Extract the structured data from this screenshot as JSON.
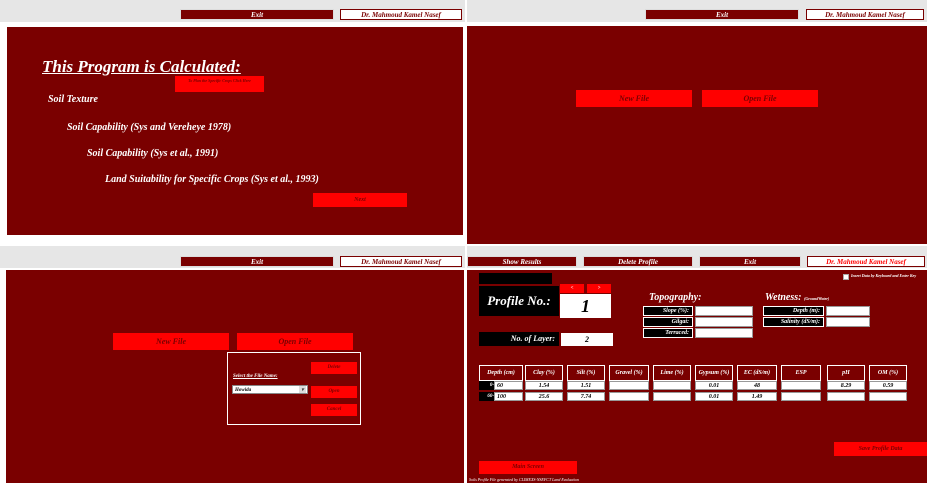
{
  "q1": {
    "exit": "Exit",
    "author": "Dr. Mahmoud Kamel Nasef",
    "heading": "This Program is Calculated:",
    "hint": "To Plan the Specific Crops Click Here",
    "items": [
      "Soil Texture",
      "Soil Capability (Sys and Vereheye 1978)",
      "Soil Capability (Sys et al., 1991)",
      "Land Suitability for Specific Crops (Sys et al., 1993)"
    ],
    "next": "Next"
  },
  "q2": {
    "exit": "Exit",
    "author": "Dr. Mahmoud Kamel Nasef",
    "new_file": "New File",
    "open_file": "Open File"
  },
  "q3": {
    "exit": "Exit",
    "author": "Dr. Mahmoud Kamel Nasef",
    "new_file": "New File",
    "open_file": "Open File",
    "select_label": "Select the File Name:",
    "selected_file": "Howida",
    "delete": "Delete",
    "open": "Open",
    "cancel": "Cancel"
  },
  "q4": {
    "tabs": [
      "Show Results",
      "Delete Profile",
      "Exit",
      "Dr. Mahmoud Kamel Nasef"
    ],
    "checkbox_label": "Insert Data by Keyboard and Enter Key",
    "nav_prev": "<",
    "nav_next": ">",
    "profile_label": "Profile No.:",
    "profile_no": "1",
    "layers_label": "No. of Layer:",
    "layers_value": "2",
    "topography": {
      "title": "Topography:",
      "fields": [
        {
          "label": "Slope (%):",
          "value": ""
        },
        {
          "label": "Gilgai:",
          "value": ""
        },
        {
          "label": "Terraced:",
          "value": ""
        }
      ]
    },
    "wetness": {
      "title": "Wetness:",
      "sub": "(GroundWater)",
      "fields": [
        {
          "label": "Depth (m):",
          "value": ""
        },
        {
          "label": "Salinity (dS/m):",
          "value": ""
        }
      ]
    },
    "table": {
      "headers": [
        "Depth (cm)",
        "Clay (%)",
        "Silt (%)",
        "Gravel (%)",
        "Lime (%)",
        "Gypsum (%)",
        "EC (dS/m)",
        "ESP",
        "pH",
        "OM (%)"
      ],
      "rows": [
        {
          "from": "0-",
          "to": "60",
          "cells": [
            "1.54",
            "1.51",
            "",
            "",
            "0.01",
            "48",
            "",
            "8.29",
            "0.59"
          ]
        },
        {
          "from": "60-",
          "to": "100",
          "cells": [
            "25.6",
            "7.74",
            "",
            "",
            "0.01",
            "1.49",
            "",
            "",
            ""
          ]
        }
      ]
    },
    "save": "Save Profile Data",
    "main_screen": "Main Screen",
    "status": "Soils Profile File generated by CLIMEXS-NSEFCT Land Evaluation"
  }
}
